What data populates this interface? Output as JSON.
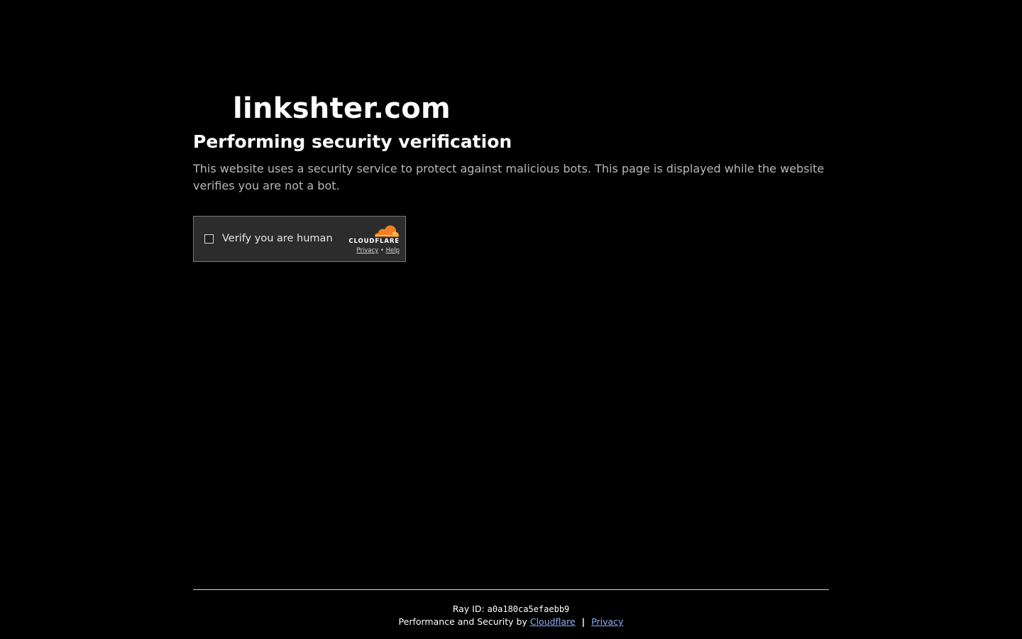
{
  "site": {
    "name": "linkshter.com"
  },
  "verification": {
    "title": "Performing security verification",
    "description": "This website uses a security service to protect against malicious bots. This page is displayed while the website verifies you are not a bot."
  },
  "widget": {
    "checkbox_label": "Verify you are human",
    "checked": false,
    "brand": "CLOUDFLARE",
    "privacy_link": "Privacy",
    "link_separator": "•",
    "help_link": "Help",
    "logo_icon": "cloudflare-cloud-icon"
  },
  "footer": {
    "ray_label": "Ray ID:",
    "ray_id": "a0a180ca5efaebb9",
    "perf_prefix": "Performance and Security by",
    "cloudflare_link": "Cloudflare",
    "separator": "|",
    "privacy_link": "Privacy"
  },
  "colors": {
    "background": "#000000",
    "widget_background": "#2c2c2c",
    "cloudflare_orange": "#f38020",
    "cloudflare_light_orange": "#faae40",
    "link": "#8aaef5"
  }
}
